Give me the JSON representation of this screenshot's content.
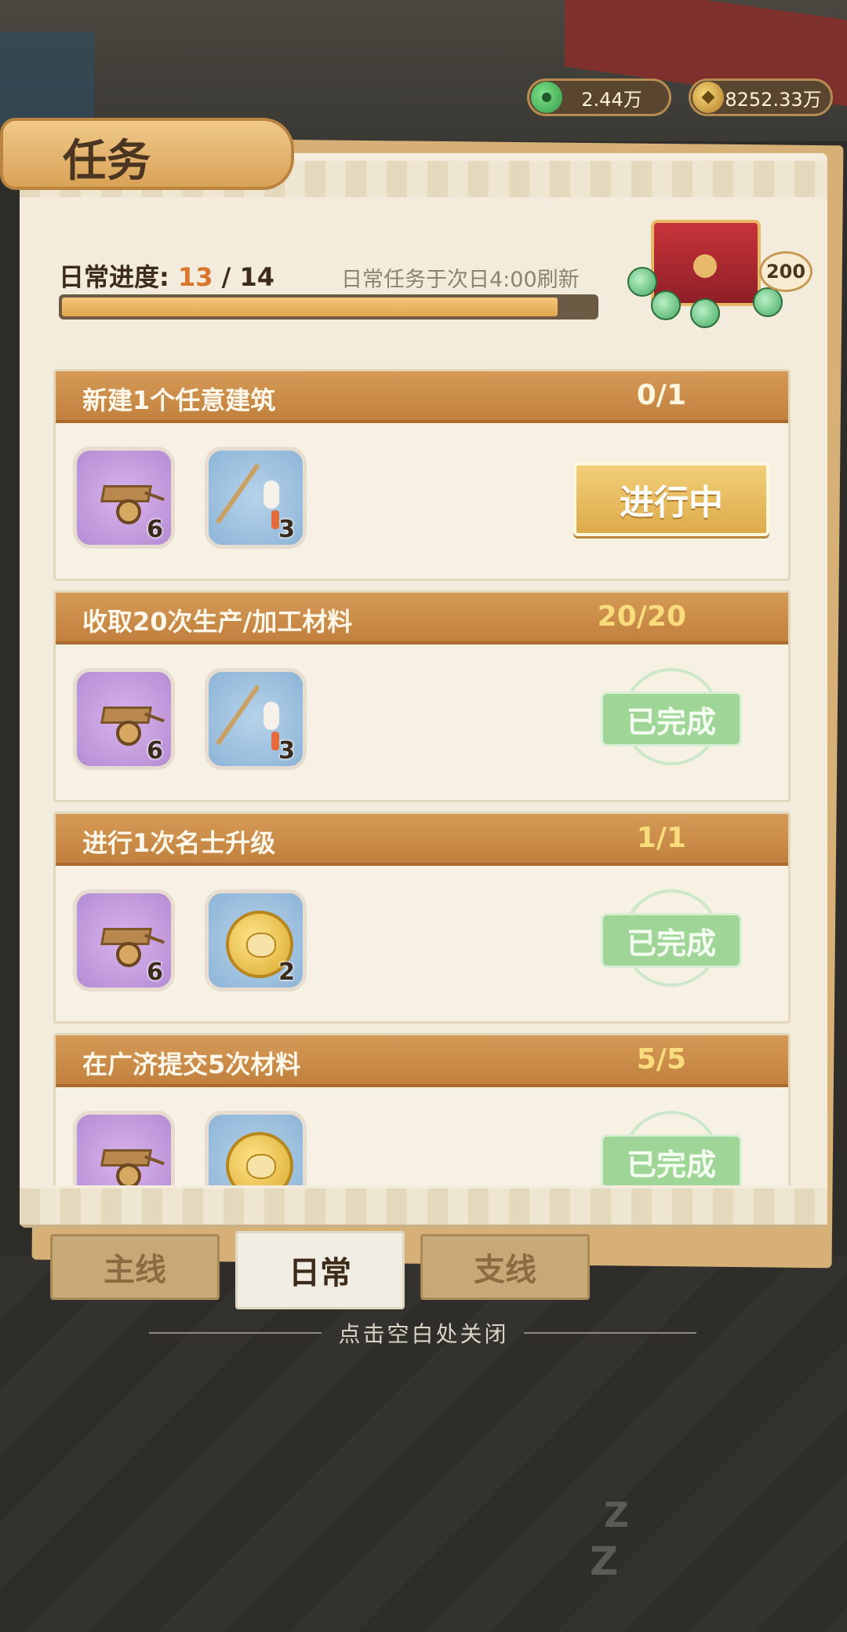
{
  "currency": [
    {
      "icon": "jade-coin-icon",
      "value": "2.44万"
    },
    {
      "icon": "copper-coin-icon",
      "value": "8252.33万"
    }
  ],
  "title": "任务",
  "progress": {
    "label": "日常进度:",
    "current": "13",
    "separator": " / ",
    "total": "14",
    "fraction": 0.93,
    "refresh_note": "日常任务于次日4:00刷新"
  },
  "chest": {
    "icon": "treasure-chest-icon",
    "badge": "200"
  },
  "tasks": [
    {
      "name": "新建1个任意建筑",
      "count": "0/1",
      "status": "进行中",
      "rewards": [
        {
          "icon": "cart-icon",
          "qty": "6"
        },
        {
          "icon": "brush-icon",
          "qty": "3"
        }
      ]
    },
    {
      "name": "收取20次生产/加工材料",
      "count": "20/20",
      "status": "已完成",
      "rewards": [
        {
          "icon": "cart-icon",
          "qty": "6"
        },
        {
          "icon": "brush-icon",
          "qty": "3"
        }
      ]
    },
    {
      "name": "进行1次名士升级",
      "count": "1/1",
      "status": "已完成",
      "rewards": [
        {
          "icon": "cart-icon",
          "qty": "6"
        },
        {
          "icon": "gold-coin-icon",
          "qty": "2"
        }
      ]
    },
    {
      "name": "在广济提交5次材料",
      "count": "5/5",
      "status": "已完成",
      "rewards": [
        {
          "icon": "cart-icon",
          "qty": ""
        },
        {
          "icon": "gold-coin-icon",
          "qty": ""
        }
      ]
    }
  ],
  "tabs": [
    {
      "label": "主线",
      "active": false
    },
    {
      "label": "日常",
      "active": true
    },
    {
      "label": "支线",
      "active": false
    }
  ],
  "close_hint": "点击空白处关闭",
  "colors": {
    "accent_orange": "#d9762e",
    "header_brown": "#c2813e",
    "complete_green": "#9fd597",
    "button_gold": "#ddab4b"
  }
}
